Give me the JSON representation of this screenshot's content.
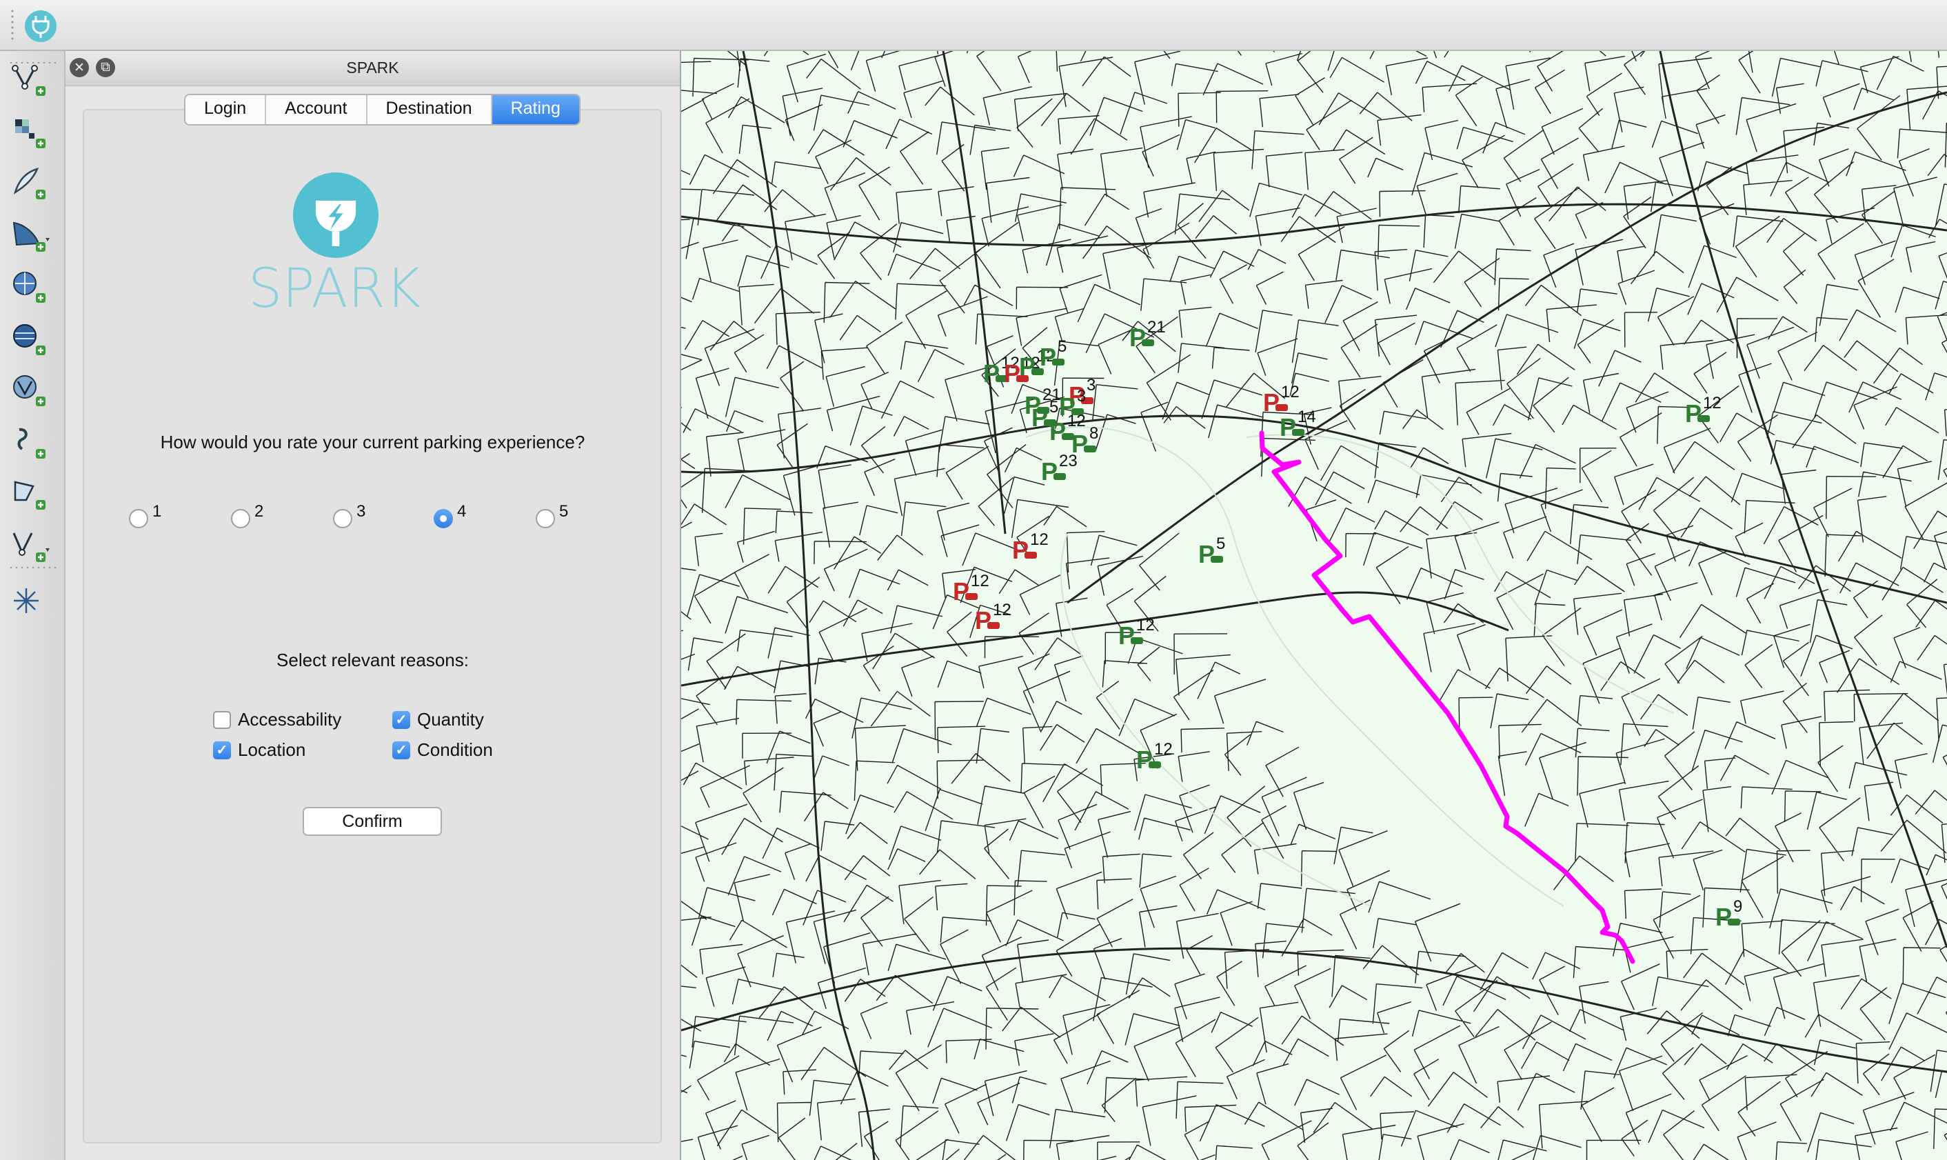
{
  "panel": {
    "title": "SPARK",
    "tabs": [
      "Login",
      "Account",
      "Destination",
      "Rating"
    ],
    "active_tab": "Rating",
    "logo_text": "SPARK",
    "brand_color": "#52c0d0",
    "question": "How would you rate your current parking experience?",
    "ratings": [
      "1",
      "2",
      "3",
      "4",
      "5"
    ],
    "selected_rating": "4",
    "reasons_title": "Select relevant reasons:",
    "reasons": [
      {
        "label": "Accessability",
        "checked": false
      },
      {
        "label": "Quantity",
        "checked": true
      },
      {
        "label": "Location",
        "checked": true
      },
      {
        "label": "Condition",
        "checked": true
      }
    ],
    "confirm_label": "Confirm"
  },
  "toolbar": {
    "icons": [
      "add-vector-layer-icon",
      "add-raster-layer-icon",
      "add-delimited-text-layer-icon",
      "add-spatialite-layer-icon",
      "add-wms-layer-icon",
      "add-wcs-layer-icon",
      "add-wfs-layer-icon",
      "new-shapefile-layer-icon",
      "add-virtual-layer-icon",
      "new-vertex-layer-icon",
      "gps-icon"
    ]
  },
  "map": {
    "route_color": "#ff00ff",
    "available_color": "#2e7d32",
    "full_color": "#c62828",
    "markers": [
      {
        "label": "12",
        "status": "available"
      },
      {
        "label": "12",
        "status": "full"
      },
      {
        "label": "12",
        "status": "available"
      },
      {
        "label": "5",
        "status": "available"
      },
      {
        "label": "21",
        "status": "available"
      },
      {
        "label": "21",
        "status": "available"
      },
      {
        "label": "5",
        "status": "available"
      },
      {
        "label": "3",
        "status": "full"
      },
      {
        "label": "3",
        "status": "available"
      },
      {
        "label": "12",
        "status": "available"
      },
      {
        "label": "8",
        "status": "available"
      },
      {
        "label": "12",
        "status": "full"
      },
      {
        "label": "14",
        "status": "available"
      },
      {
        "label": "23",
        "status": "available"
      },
      {
        "label": "12",
        "status": "full"
      },
      {
        "label": "5",
        "status": "available"
      },
      {
        "label": "12",
        "status": "full"
      },
      {
        "label": "12",
        "status": "full"
      },
      {
        "label": "12",
        "status": "available"
      },
      {
        "label": "12",
        "status": "available"
      },
      {
        "label": "12",
        "status": "available"
      },
      {
        "label": "9",
        "status": "available"
      }
    ]
  }
}
